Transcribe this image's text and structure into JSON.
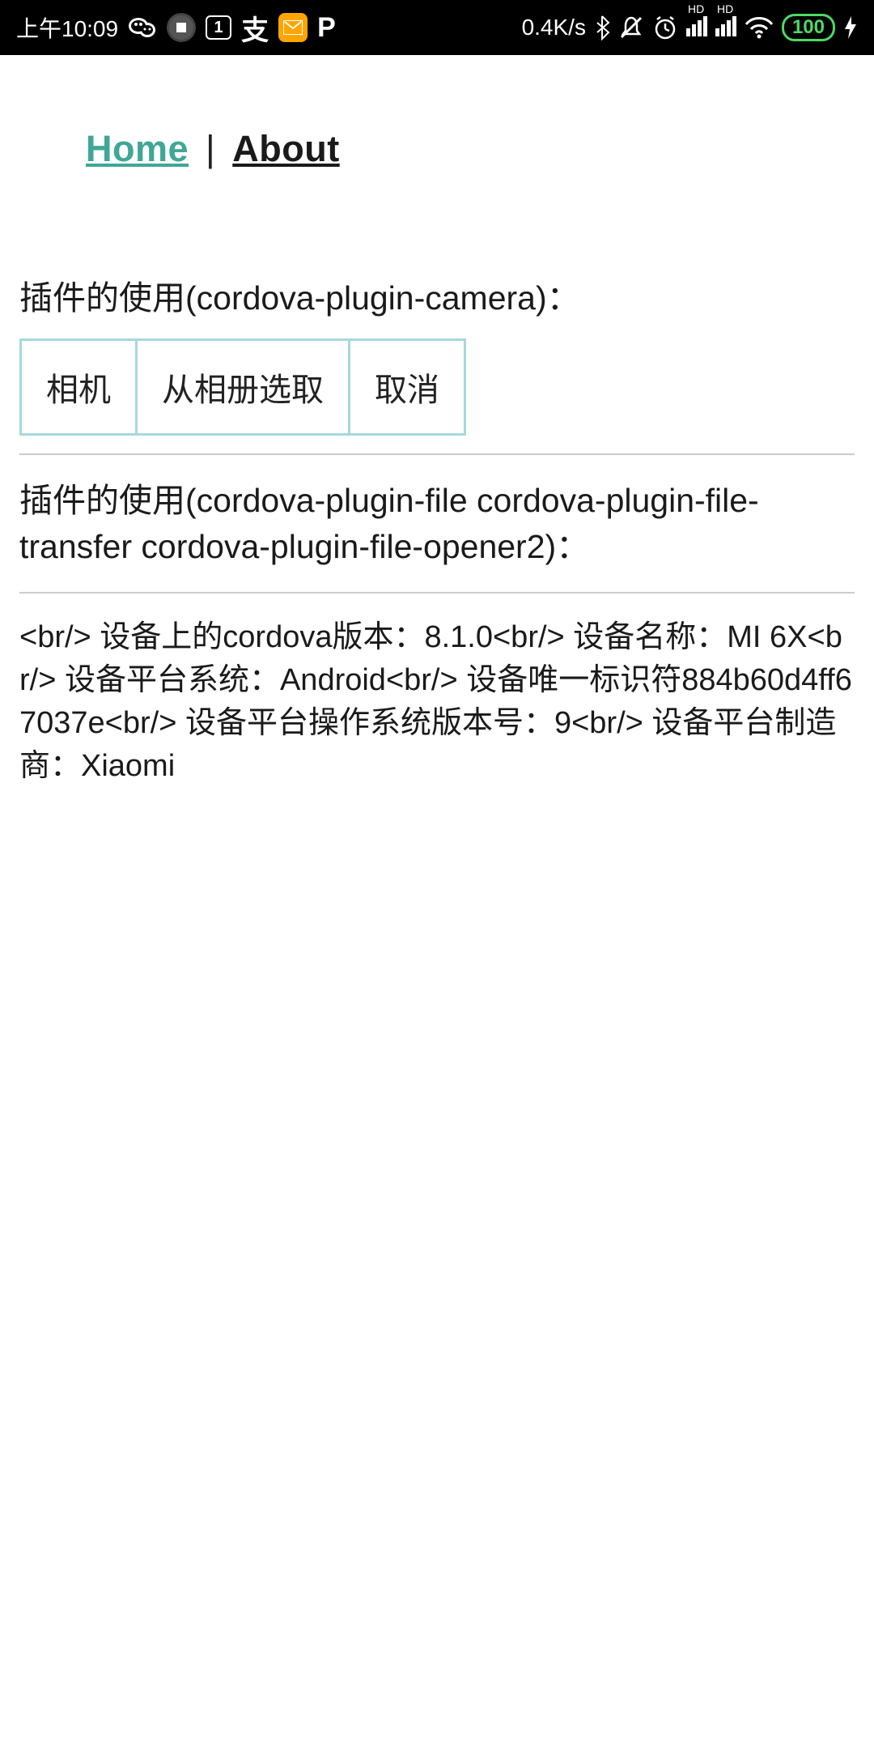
{
  "status": {
    "time": "上午10:09",
    "speed": "0.4K/s",
    "battery": "100",
    "calendar_day": "1"
  },
  "nav": {
    "home": "Home",
    "separator": "|",
    "about": "About"
  },
  "section1": {
    "title": "插件的使用(cordova-plugin-camera)：",
    "buttons": {
      "camera": "相机",
      "gallery": "从相册选取",
      "cancel": "取消"
    }
  },
  "section2": {
    "title": "插件的使用(cordova-plugin-file cordova-plugin-file-transfer cordova-plugin-file-opener2)："
  },
  "device_info": "<br/> 设备上的cordova版本：8.1.0<br/> 设备名称：MI 6X<br/> 设备平台系统：Android<br/> 设备唯一标识符884b60d4ff67037e<br/> 设备平台操作系统版本号：9<br/> 设备平台制造商：Xiaomi"
}
